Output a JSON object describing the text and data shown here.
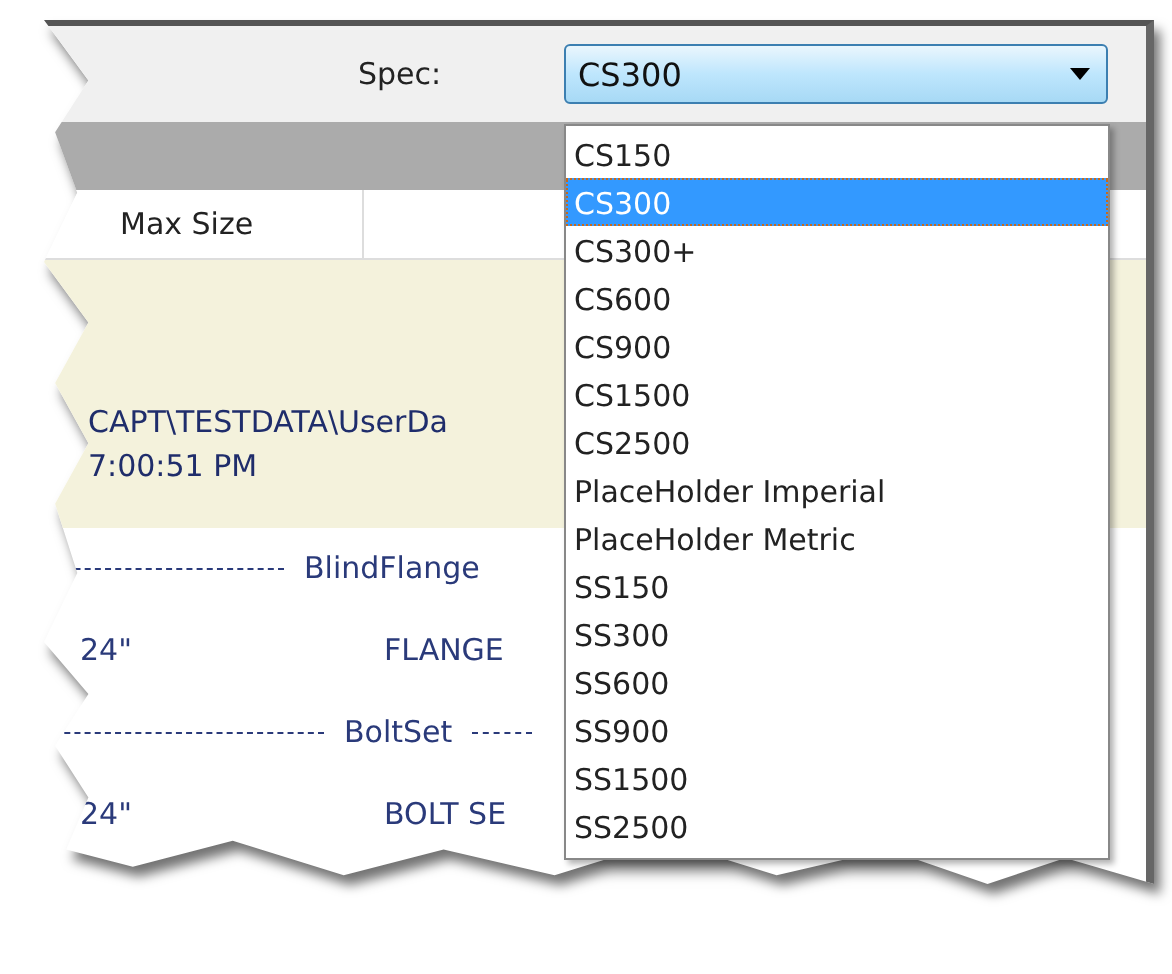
{
  "spec": {
    "label": "Spec:",
    "value": "CS300",
    "expanded": true
  },
  "options": [
    {
      "label": "CS150",
      "selected": false
    },
    {
      "label": "CS300",
      "selected": true
    },
    {
      "label": "CS300+",
      "selected": false
    },
    {
      "label": "CS600",
      "selected": false
    },
    {
      "label": "CS900",
      "selected": false
    },
    {
      "label": "CS1500",
      "selected": false
    },
    {
      "label": "CS2500",
      "selected": false
    },
    {
      "label": "PlaceHolder Imperial",
      "selected": false
    },
    {
      "label": "PlaceHolder Metric",
      "selected": false
    },
    {
      "label": "SS150",
      "selected": false
    },
    {
      "label": "SS300",
      "selected": false
    },
    {
      "label": "SS600",
      "selected": false
    },
    {
      "label": "SS900",
      "selected": false
    },
    {
      "label": "SS1500",
      "selected": false
    },
    {
      "label": "SS2500",
      "selected": false
    }
  ],
  "table": {
    "columns": [
      "Max Size"
    ],
    "info": [
      "CAPT\\TESTDATA\\UserDa",
      "7:00:51 PM"
    ],
    "groups": [
      {
        "name": "BlindFlange",
        "rows": [
          {
            "size": "24\"",
            "description": "FLANGE"
          }
        ]
      },
      {
        "name": "BoltSet",
        "rows": [
          {
            "size": "24\"",
            "description": "BOLT SE"
          }
        ]
      }
    ]
  }
}
